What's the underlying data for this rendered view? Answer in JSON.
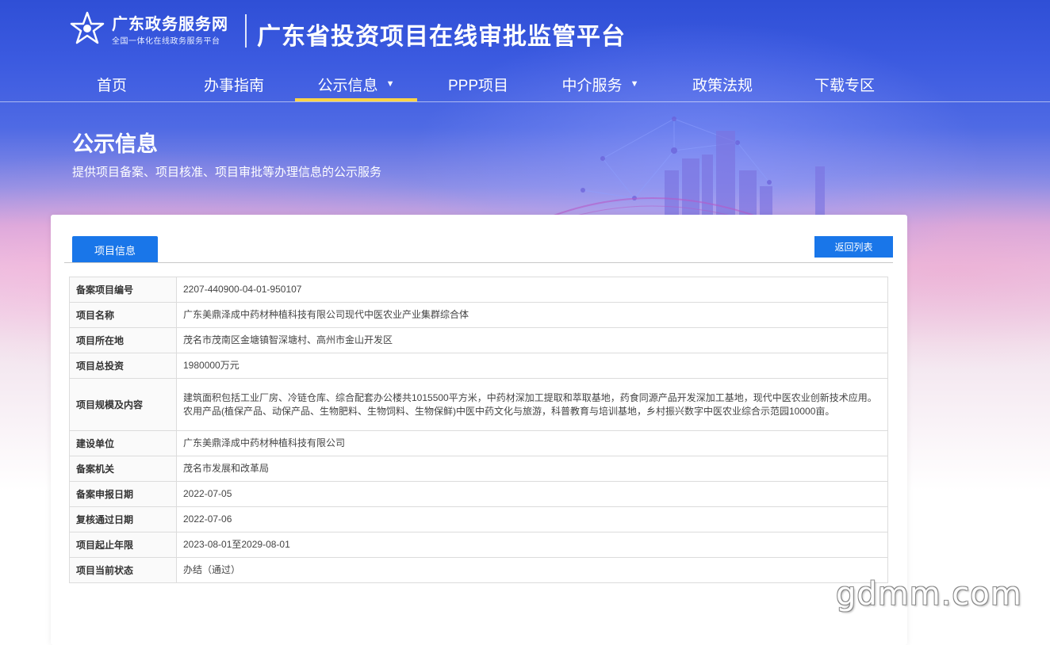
{
  "brand": {
    "name": "广东政务服务网",
    "subtitle": "全国一体化在线政务服务平台",
    "platform_title": "广东省投资项目在线审批监管平台"
  },
  "nav": {
    "items": [
      {
        "label": "首页",
        "has_dropdown": false,
        "active": false
      },
      {
        "label": "办事指南",
        "has_dropdown": false,
        "active": false
      },
      {
        "label": "公示信息",
        "has_dropdown": true,
        "active": true
      },
      {
        "label": "PPP项目",
        "has_dropdown": false,
        "active": false
      },
      {
        "label": "中介服务",
        "has_dropdown": true,
        "active": false
      },
      {
        "label": "政策法规",
        "has_dropdown": false,
        "active": false
      },
      {
        "label": "下载专区",
        "has_dropdown": false,
        "active": false
      }
    ]
  },
  "section": {
    "title": "公示信息",
    "subtitle": "提供项目备案、项目核准、项目审批等办理信息的公示服务"
  },
  "card": {
    "tab_label": "项目信息",
    "back_button": "返回列表"
  },
  "project_rows": [
    {
      "label": "备案项目编号",
      "value": "2207-440900-04-01-950107"
    },
    {
      "label": "项目名称",
      "value": "广东美鼎泽成中药材种植科技有限公司现代中医农业产业集群综合体"
    },
    {
      "label": "项目所在地",
      "value": "茂名市茂南区金塘镇智深塘村、高州市金山开发区"
    },
    {
      "label": "项目总投资",
      "value": "1980000万元"
    },
    {
      "label": "项目规模及内容",
      "value": "建筑面积包括工业厂房、冷链仓库、综合配套办公楼共1015500平方米，中药材深加工提取和萃取基地，药食同源产品开发深加工基地，现代中医农业创新技术应用。农用产品(植保产品、动保产品、生物肥料、生物饲料、生物保鲜)中医中药文化与旅游，科普教育与培训基地，乡村振兴数字中医农业综合示范园10000亩。"
    },
    {
      "label": "建设单位",
      "value": "广东美鼎泽成中药材种植科技有限公司"
    },
    {
      "label": "备案机关",
      "value": "茂名市发展和改革局"
    },
    {
      "label": "备案申报日期",
      "value": "2022-07-05"
    },
    {
      "label": "复核通过日期",
      "value": "2022-07-06"
    },
    {
      "label": "项目起止年限",
      "value": "2023-08-01至2029-08-01"
    },
    {
      "label": "项目当前状态",
      "value": "办结（通过）"
    }
  ],
  "watermark": "gdmm.com",
  "colors": {
    "primary_blue": "#1976e9",
    "nav_active_underline": "#ffd447",
    "header_blue": "#2f4fd6"
  },
  "icons": {
    "logo": "guangdong-gov-service-logo",
    "dropdown": "caret-down-icon"
  }
}
